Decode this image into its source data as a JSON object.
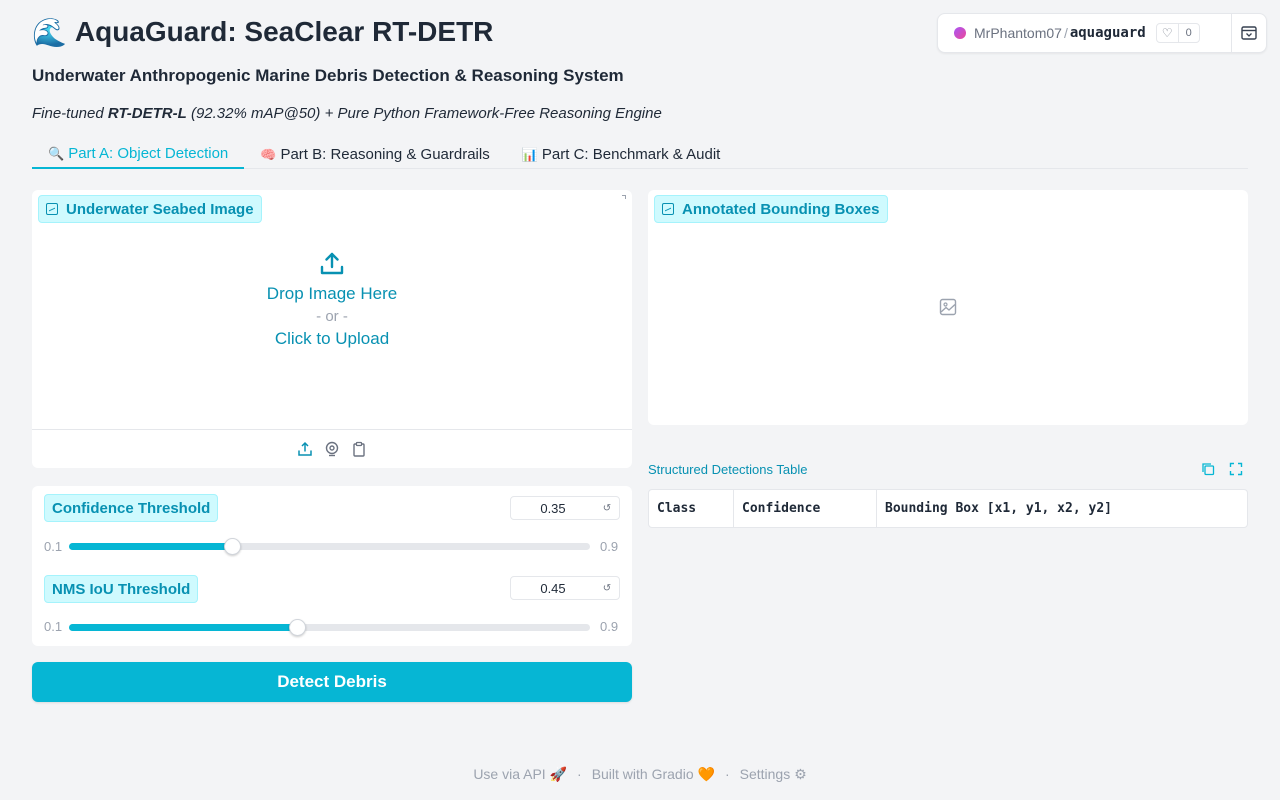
{
  "header": {
    "emoji": "🌊",
    "title": "AquaGuard: SeaClear RT-DETR",
    "subtitle": "Underwater Anthropogenic Marine Debris Detection & Reasoning System",
    "tagline_prefix": "Fine-tuned ",
    "tagline_model": "RT-DETR-L",
    "tagline_suffix": " (92.32% mAP@50) + Pure Python Framework-Free Reasoning Engine"
  },
  "space_badge": {
    "owner": "MrPhantom07",
    "separator": "/",
    "space": "aquaguard",
    "likes": "0"
  },
  "tabs": [
    {
      "icon": "🔍",
      "label": "Part A: Object Detection",
      "active": true
    },
    {
      "icon": "🧠",
      "label": "Part B: Reasoning & Guardrails",
      "active": false
    },
    {
      "icon": "📊",
      "label": "Part C: Benchmark & Audit",
      "active": false
    }
  ],
  "upload": {
    "label": "Underwater Seabed Image",
    "drop_text": "Drop Image Here",
    "or_text": "- or -",
    "click_text": "Click to Upload"
  },
  "output": {
    "label": "Annotated Bounding Boxes"
  },
  "sliders": {
    "confidence": {
      "label": "Confidence Threshold",
      "value": "0.35",
      "min": "0.1",
      "max": "0.9",
      "fraction": 0.3125
    },
    "nms": {
      "label": "NMS IoU Threshold",
      "value": "0.45",
      "min": "0.1",
      "max": "0.9",
      "fraction": 0.4375
    }
  },
  "detect_button": "Detect Debris",
  "table": {
    "title": "Structured Detections Table",
    "columns": [
      "Class",
      "Confidence",
      "Bounding Box [x1, y1, x2, y2]"
    ]
  },
  "footer": {
    "api": "Use via API",
    "api_icon": "🚀",
    "built": "Built with Gradio",
    "built_icon": "🧡",
    "settings": "Settings",
    "settings_icon": "⚙"
  },
  "colors": {
    "accent": "#06b6d4",
    "accent_dark": "#0891b2",
    "chip_bg": "#cffafe"
  }
}
